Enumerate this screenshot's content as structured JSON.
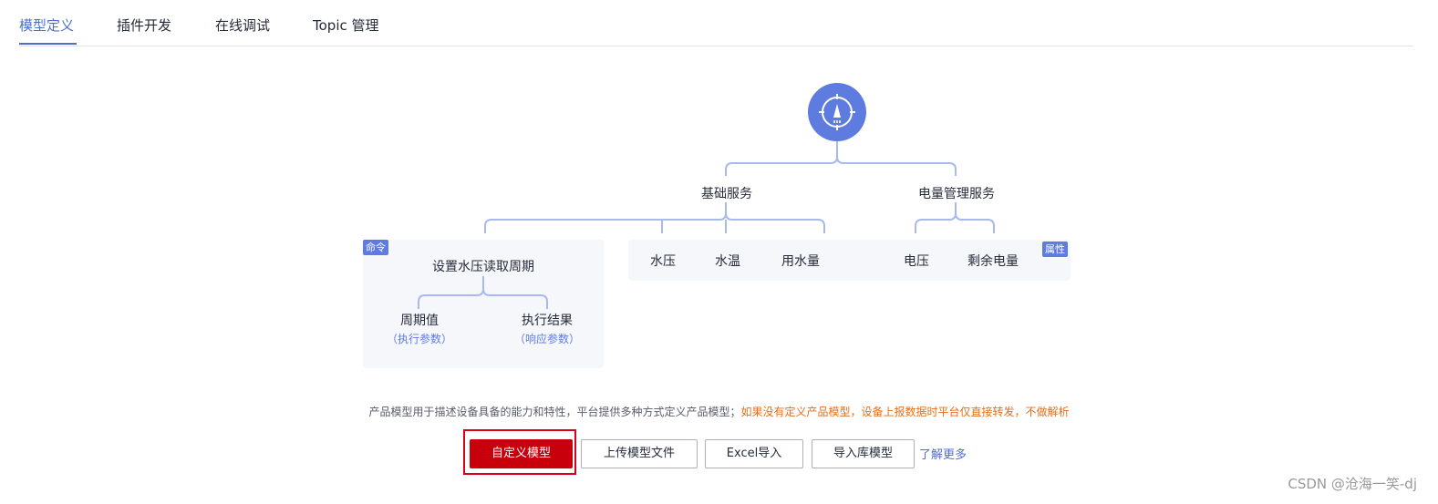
{
  "tabs": [
    {
      "label": "模型定义",
      "active": true
    },
    {
      "label": "插件开发",
      "active": false
    },
    {
      "label": "在线调试",
      "active": false
    },
    {
      "label": "Topic 管理",
      "active": false
    }
  ],
  "diagram": {
    "root_icon": "compass-icon",
    "services": {
      "basic": "基础服务",
      "power": "电量管理服务"
    },
    "command_panel": {
      "tag": "命令",
      "title": "设置水压读取周期",
      "param_left": {
        "label": "周期值",
        "sub": "（执行参数）"
      },
      "param_right": {
        "label": "执行结果",
        "sub": "（响应参数）"
      }
    },
    "property_panel": {
      "tag": "属性",
      "items": [
        "水压",
        "水温",
        "用水量",
        "电压",
        "剩余电量"
      ]
    }
  },
  "description": {
    "normal": "产品模型用于描述设备具备的能力和特性，平台提供多种方式定义产品模型；",
    "warning": "如果没有定义产品模型，设备上报数据时平台仅直接转发，不做解析"
  },
  "buttons": {
    "custom_model": "自定义模型",
    "upload_model_file": "上传模型文件",
    "excel_import": "Excel导入",
    "import_library_model": "导入库模型",
    "learn_more": "了解更多"
  },
  "watermark": "CSDN @沧海一笑-dj",
  "colors": {
    "accent": "#5e7ce0",
    "tab_active": "#526ecc",
    "primary_button": "#c7000b",
    "warning_text": "#e56e19",
    "connector": "#a8b9f0",
    "panel_bg": "#f5f7fb"
  }
}
